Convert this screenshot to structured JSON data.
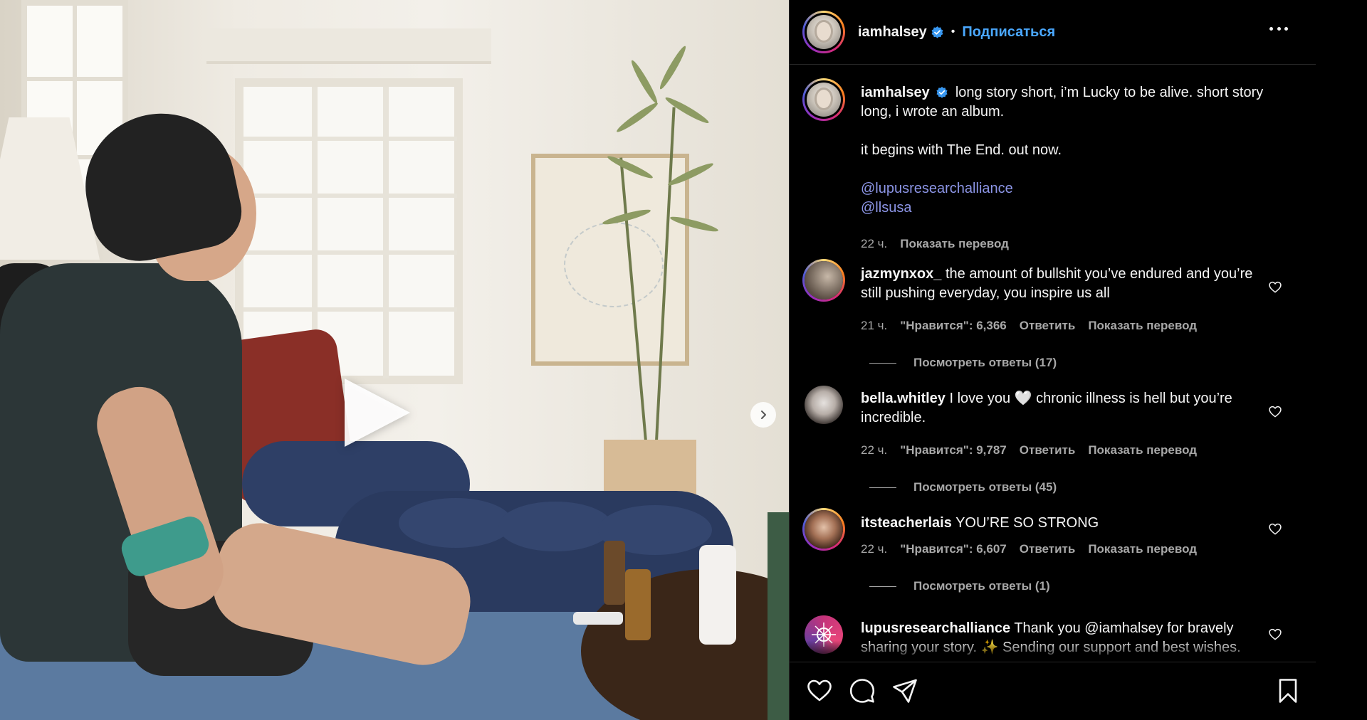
{
  "post": {
    "username": "iamhalsey",
    "follow_label": "Подписаться",
    "separator": "•"
  },
  "caption": {
    "username": "iamhalsey",
    "line1": "long story short, i’m Lucky to be alive. short story long, i wrote an album.",
    "line2": "it begins with The End. out now.",
    "mention1": "@lupusresearchalliance",
    "mention2": "@llsusa",
    "time": "22 ч.",
    "translate": "Показать перевод"
  },
  "comments": [
    {
      "username": "jazmynxox_",
      "text": "the amount of bullshit you’ve endured and you’re still pushing everyday, you inspire us all",
      "time": "21 ч.",
      "likes": "\"Нравится\": 6,366",
      "reply": "Ответить",
      "translate": "Показать перевод",
      "view_replies": "Посмотреть ответы (17)"
    },
    {
      "username": "bella.whitley",
      "text": "I love you 🤍 chronic illness is hell but you’re incredible.",
      "time": "22 ч.",
      "likes": "\"Нравится\": 9,787",
      "reply": "Ответить",
      "translate": "Показать перевод",
      "view_replies": "Посмотреть ответы (45)"
    },
    {
      "username": "itsteacherlais",
      "text": "YOU’RE SO STRONG",
      "time": "22 ч.",
      "likes": "\"Нравится\": 6,607",
      "reply": "Ответить",
      "translate": "Показать перевод",
      "view_replies": "Посмотреть ответы (1)"
    },
    {
      "username": "lupusresearchalliance",
      "text": "Thank you @iamhalsey for bravely sharing your story. ✨ Sending our support and best wishes."
    }
  ],
  "icons": {
    "like": "heart-icon",
    "comment": "comment-icon",
    "share": "send-icon",
    "save": "bookmark-icon",
    "play": "play-icon",
    "next": "chevron-right-icon",
    "more": "more-icon",
    "verified": "verified-badge-icon"
  },
  "colors": {
    "follow": "#4aa8ff",
    "mention": "#8c95e6",
    "verified": "#3897f0",
    "muted": "#a8a8a8"
  }
}
